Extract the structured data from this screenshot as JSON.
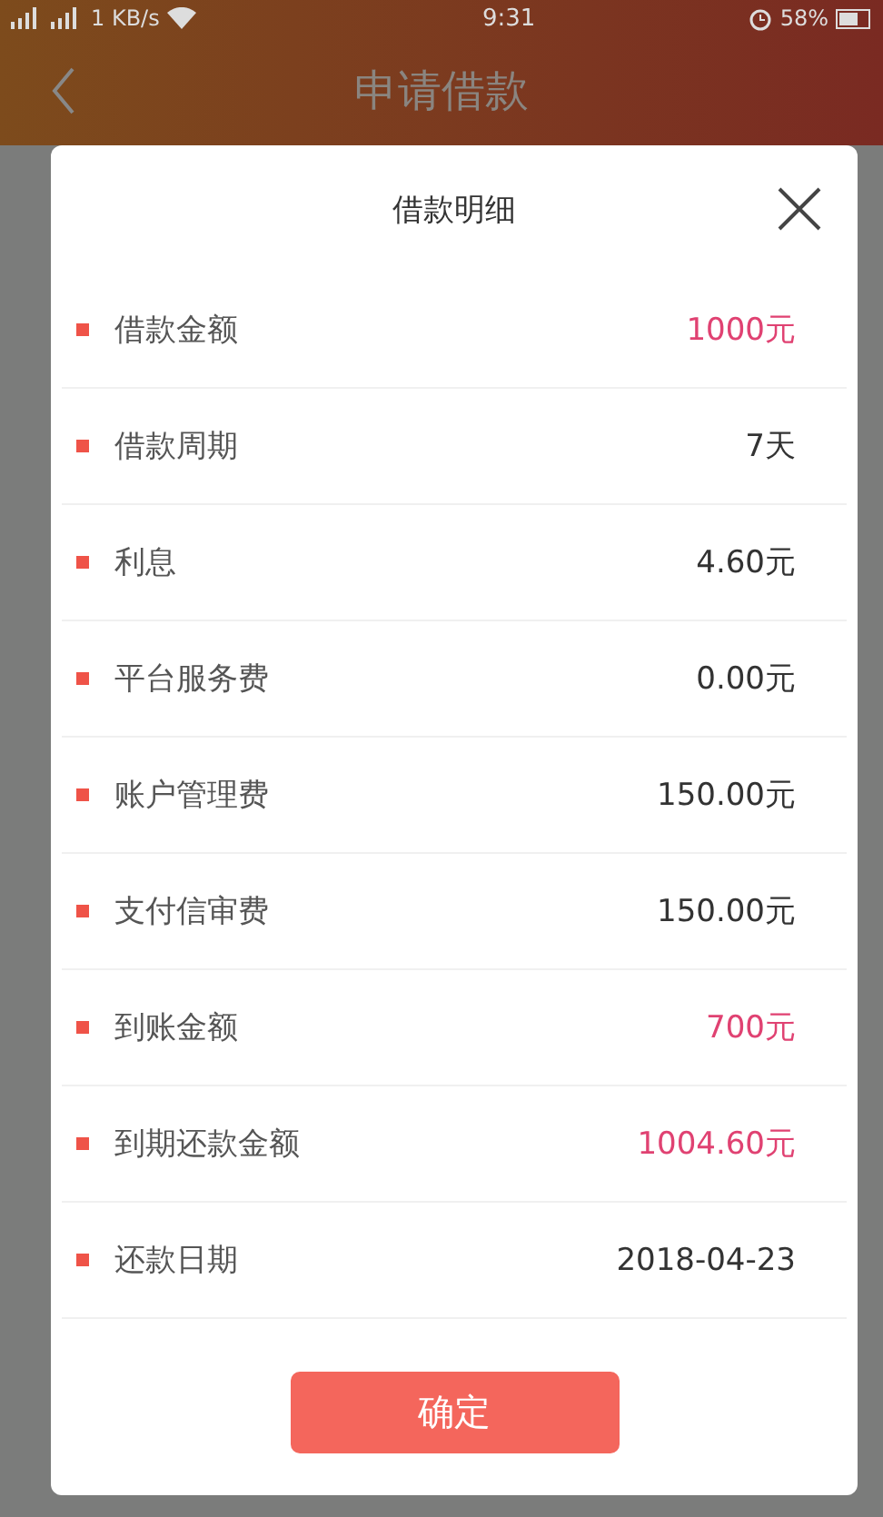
{
  "status_bar": {
    "speed": "1 KB/s",
    "time": "9:31",
    "battery": "58%"
  },
  "header": {
    "title": "申请借款"
  },
  "dialog": {
    "title": "借款明细",
    "rows": [
      {
        "label": "借款金额",
        "value": "1000元",
        "highlight": true
      },
      {
        "label": "借款周期",
        "value": "7天",
        "highlight": false
      },
      {
        "label": "利息",
        "value": "4.60元",
        "highlight": false
      },
      {
        "label": "平台服务费",
        "value": "0.00元",
        "highlight": false
      },
      {
        "label": "账户管理费",
        "value": "150.00元",
        "highlight": false
      },
      {
        "label": "支付信审费",
        "value": "150.00元",
        "highlight": false
      },
      {
        "label": "到账金额",
        "value": "700元",
        "highlight": true
      },
      {
        "label": "到期还款金额",
        "value": "1004.60元",
        "highlight": true
      },
      {
        "label": "还款日期",
        "value": "2018-04-23",
        "highlight": false
      }
    ],
    "confirm": "确定"
  }
}
